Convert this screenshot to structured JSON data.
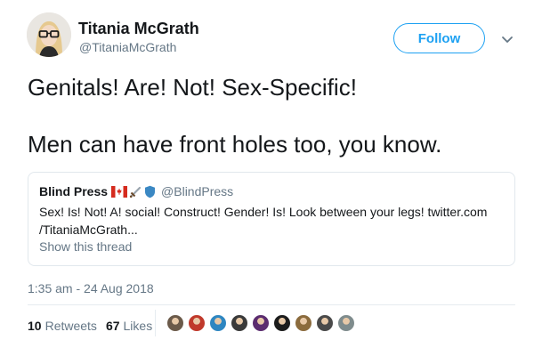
{
  "author": {
    "name": "Titania McGrath",
    "handle": "@TitaniaMcGrath",
    "avatar_icon": "user-avatar-portrait"
  },
  "follow_label": "Follow",
  "more_icon": "chevron-down-icon",
  "tweet": {
    "line1": "Genitals! Are! Not! Sex-Specific!",
    "line2": "Men can have front holes too, you know."
  },
  "quote": {
    "name": "Blind Press",
    "emoji_icons": [
      "canada-flag-icon",
      "dagger-icon",
      "shield-icon"
    ],
    "handle": "@BlindPress",
    "text": "Sex! Is! Not! A! social! Construct! Gender! Is! Look between your legs! twitter.com /TitaniaMcGrath...",
    "show_thread": "Show this thread"
  },
  "timestamp": "1:35 am - 24 Aug 2018",
  "stats": {
    "retweets_count": "10",
    "retweets_label": "Retweets",
    "likes_count": "67",
    "likes_label": "Likes"
  },
  "liker_avatars": [
    "#6b5a4a",
    "#c0392b",
    "#2e86c1",
    "#3a3a3a",
    "#5b2c6f",
    "#1c1c1c",
    "#8b6b3d",
    "#4a4a4a",
    "#7f8c8d"
  ],
  "colors": {
    "accent": "#1da1f2",
    "text_primary": "#14171a",
    "text_secondary": "#657786",
    "border": "#e1e8ed"
  }
}
